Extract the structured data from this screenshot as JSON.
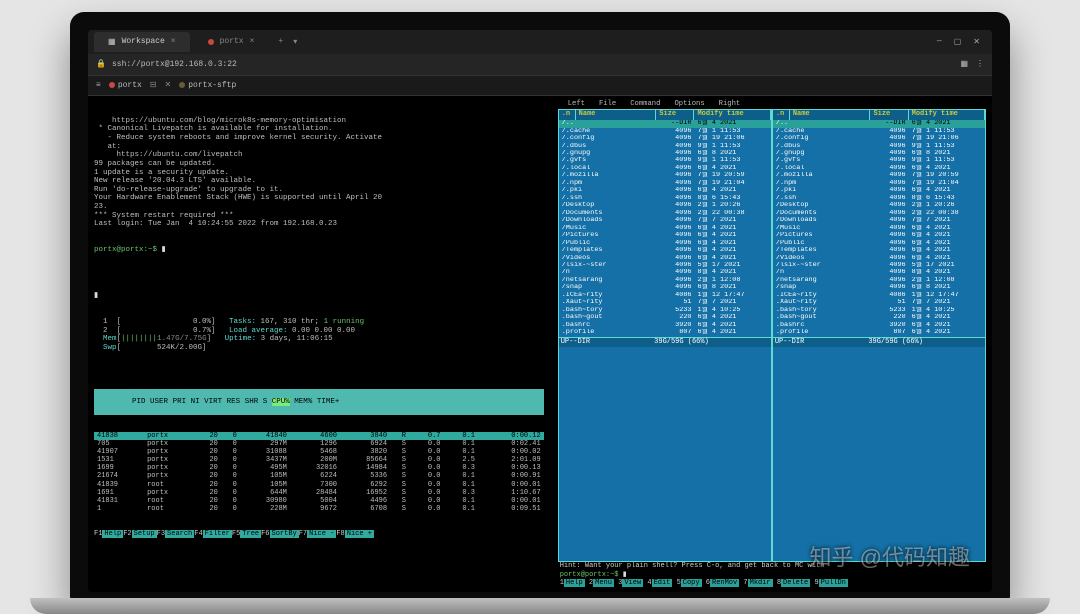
{
  "titlebar": {
    "tabs": [
      {
        "icon": "grid",
        "label": "Workspace",
        "closable": true,
        "active": true
      },
      {
        "icon": "dot",
        "label": "portx",
        "closable": true,
        "active": false
      }
    ],
    "plus": "+",
    "controls": [
      "—",
      "▢",
      "✕"
    ]
  },
  "addressbar": {
    "lock_icon": "lock-icon",
    "text": "ssh://portx@192.168.0.3:22",
    "right_icons": [
      "grid-icon",
      "gear-icon"
    ]
  },
  "tooltabs": [
    {
      "icon": "hamburger",
      "label": ""
    },
    {
      "icon": "dot-red",
      "label": "portx"
    },
    {
      "icon": "close-thin",
      "label": ""
    },
    {
      "icon": "x-small",
      "label": ""
    },
    {
      "icon": "dot-brown",
      "label": "portx-sftp"
    }
  ],
  "left_pane": {
    "motd": [
      "    https://ubuntu.com/blog/microk8s-memory-optimisation",
      "",
      " * Canonical Livepatch is available for installation.",
      "   - Reduce system reboots and improve kernel security. Activate",
      "   at:",
      "     https://ubuntu.com/livepatch",
      "",
      "99 packages can be updated.",
      "1 update is a security update.",
      "",
      "New release '20.04.3 LTS' available.",
      "Run 'do-release-upgrade' to upgrade to it.",
      "",
      "Your Hardware Enablement Stack (HWE) is supported until April 20",
      "23.",
      "*** System restart required ***",
      "Last login: Tue Jan  4 10:24:55 2022 from 192.168.0.23"
    ],
    "prompt": "portx@portx:~$ ",
    "cursor": "▮",
    "htop_summary": {
      "rows": [
        "  1  [                0.0%]   Tasks: 167, 310 thr; 1 running",
        "  2  [                0.7%]   Load average: 0.00 0.00 0.00",
        "  Mem[||||||||1.47G/7.75G]   Uptime: 3 days, 11:06:15",
        "  Swp[        524K/2.00G]"
      ]
    },
    "proc_header": [
      "PID",
      "USER",
      "PRI",
      "NI",
      "VIRT",
      "RES",
      "SHR",
      "S",
      "CPU%",
      "MEM%",
      "TIME+"
    ],
    "proc_rows": [
      {
        "sel": true,
        "c": [
          "41838",
          "portx",
          "20",
          "0",
          "41840",
          "4600",
          "3840",
          "R",
          "0.7",
          "0.1",
          "0:00.12"
        ]
      },
      {
        "c": [
          "705",
          "portx",
          "20",
          "0",
          "297M",
          "1296",
          "6924",
          "S",
          "0.0",
          "0.1",
          "0:02.41"
        ]
      },
      {
        "c": [
          "41907",
          "portx",
          "20",
          "0",
          "31088",
          "5468",
          "3820",
          "S",
          "0.0",
          "0.1",
          "0:00.02"
        ]
      },
      {
        "c": [
          "1531",
          "portx",
          "20",
          "0",
          "3437M",
          "200M",
          "85664",
          "S",
          "0.0",
          "2.5",
          "2:01.09"
        ]
      },
      {
        "c": [
          "1699",
          "portx",
          "20",
          "0",
          "495M",
          "32016",
          "14984",
          "S",
          "0.0",
          "0.3",
          "0:00.13"
        ]
      },
      {
        "c": [
          "21674",
          "portx",
          "20",
          "0",
          "105M",
          "6224",
          "5336",
          "S",
          "0.0",
          "0.1",
          "0:00.91"
        ]
      },
      {
        "c": [
          "41839",
          "root",
          "20",
          "0",
          "105M",
          "7300",
          "6292",
          "S",
          "0.0",
          "0.1",
          "0:00.01"
        ]
      },
      {
        "c": [
          "1691",
          "portx",
          "20",
          "0",
          "644M",
          "28484",
          "16952",
          "S",
          "0.0",
          "0.3",
          "1:10.67"
        ]
      },
      {
        "c": [
          "41831",
          "root",
          "20",
          "0",
          "30980",
          "5004",
          "4496",
          "S",
          "0.0",
          "0.1",
          "0:00.01"
        ]
      },
      {
        "c": [
          "1",
          "root",
          "20",
          "0",
          "228M",
          "9672",
          "6708",
          "S",
          "0.0",
          "0.1",
          "0:09.51"
        ]
      }
    ],
    "fn_keys": [
      [
        "F1",
        "Help"
      ],
      [
        "F2",
        "Setup"
      ],
      [
        "F3",
        "Search"
      ],
      [
        "F4",
        "Filter"
      ],
      [
        "F5",
        "Tree"
      ],
      [
        "F6",
        "SortBy"
      ],
      [
        "F7",
        "Nice -"
      ],
      [
        "F8",
        "Nice +"
      ]
    ]
  },
  "mc": {
    "menu": [
      "Left",
      "File",
      "Command",
      "Options",
      "Right"
    ],
    "columns": [
      ".n",
      "Name",
      "Size",
      "Modify time"
    ],
    "updir_row": {
      "name": "/..",
      "size": "--DIR",
      "mt": "6월  4  2021"
    },
    "rows": [
      {
        "name": "/.cache",
        "size": "4096",
        "mt": "7월  1 11:53"
      },
      {
        "name": "/.config",
        "size": "4096",
        "mt": "7월 19 21:06"
      },
      {
        "name": "/.dbus",
        "size": "4096",
        "mt": "9월  1 11:53"
      },
      {
        "name": "/.gnupg",
        "size": "4096",
        "mt": "6월  8  2021"
      },
      {
        "name": "/.gvfs",
        "size": "4096",
        "mt": "9월  1 11:53"
      },
      {
        "name": "/.local",
        "size": "4096",
        "mt": "6월  4  2021"
      },
      {
        "name": "/.mozilla",
        "size": "4096",
        "mt": "7월 19 20:59"
      },
      {
        "name": "/.npm",
        "size": "4096",
        "mt": "7월 19 21:04"
      },
      {
        "name": "/.pki",
        "size": "4096",
        "mt": "6월  4  2021"
      },
      {
        "name": "/.ssh",
        "size": "4096",
        "mt": "8월  6 15:43"
      },
      {
        "name": "/Desktop",
        "size": "4096",
        "mt": "2월  1 20:26"
      },
      {
        "name": "/Documents",
        "size": "4096",
        "mt": "2월 22 00:38"
      },
      {
        "name": "/Downloads",
        "size": "4096",
        "mt": "7월  7  2021"
      },
      {
        "name": "/Music",
        "size": "4096",
        "mt": "6월  4  2021"
      },
      {
        "name": "/Pictures",
        "size": "4096",
        "mt": "6월  4  2021"
      },
      {
        "name": "/Public",
        "size": "4096",
        "mt": "6월  4  2021"
      },
      {
        "name": "/Templates",
        "size": "4096",
        "mt": "6월  4  2021"
      },
      {
        "name": "/Videos",
        "size": "4096",
        "mt": "6월  4  2021"
      },
      {
        "name": "/lsix-~ster",
        "size": "4096",
        "mt": "5월 17  2021"
      },
      {
        "name": "/n",
        "size": "4096",
        "mt": "8월  4  2021"
      },
      {
        "name": "/netsarang",
        "size": "4096",
        "mt": "2월  1 12:08"
      },
      {
        "name": "/snap",
        "size": "4096",
        "mt": "6월  8  2021"
      },
      {
        "name": ".ICEa~rity",
        "size": "4086",
        "mt": "1월 12 17:47"
      },
      {
        "name": ".Xaut~rity",
        "size": "51",
        "mt": "7월  7  2021"
      },
      {
        "name": ".bash~tory",
        "size": "5233",
        "mt": "1월  4 10:25"
      },
      {
        "name": ".bash~gout",
        "size": "220",
        "mt": "6월  4  2021"
      },
      {
        "name": ".bashrc",
        "size": "3920",
        "mt": "6월  4  2021"
      },
      {
        "name": ".profile",
        "size": "807",
        "mt": "6월  4  2021"
      }
    ],
    "footer_left": "UP--DIR",
    "footer_center": "39G/59G (66%)",
    "hint": "Hint: Want your plain shell? Press C-o, and get back to MC with",
    "prompt": "portx@portx:~$ ",
    "fn_keys": [
      [
        "1",
        "Help"
      ],
      [
        "2",
        "Menu"
      ],
      [
        "3",
        "View"
      ],
      [
        "4",
        "Edit"
      ],
      [
        "5",
        "Copy"
      ],
      [
        "6",
        "RenMov"
      ],
      [
        "7",
        "Mkdir"
      ],
      [
        "8",
        "Delete"
      ],
      [
        "9",
        "PullDn"
      ]
    ]
  },
  "watermark": "知乎 @代码知趣"
}
